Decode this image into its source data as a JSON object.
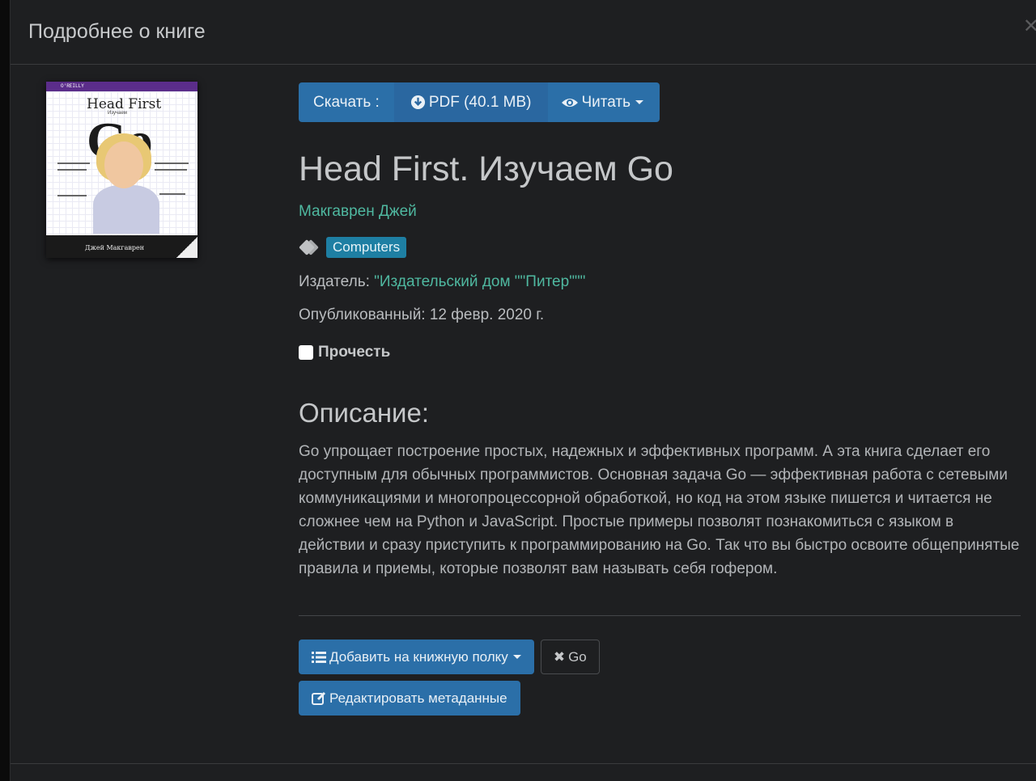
{
  "modal": {
    "title": "Подробнее о книге",
    "close_icon": "close-icon"
  },
  "book": {
    "title": "Head First. Изучаем Go",
    "author": "Макгаврен Джей",
    "tag": "Computers",
    "publisher_label": "Издатель:",
    "publisher": "\"Издательский дом \"\"Питер\"\"\"",
    "published": "Опубликованный: 12 февр. 2020 г.",
    "read_label": "Прочесть",
    "cover": {
      "brand": "O'REILLY",
      "series": "Head First",
      "subtitle": "Изучаем",
      "word": "Go",
      "author": "Джей Макгаврен"
    }
  },
  "download": {
    "label": "Скачать :",
    "pdf": "PDF (40.1 MB)",
    "read": "Читать"
  },
  "description": {
    "heading": "Описание:",
    "text": "Go упрощает построение простых, надежных и эффективных программ. А эта книга сделает его доступным для обычных программистов. Основная задача Go — эффективная работа с сетевыми коммуникациями и многопроцессорной обработкой, но код на этом языке пишется и читается не сложнее чем на Python и JavaScript. Простые примеры позволят познакомиться с языком в действии и сразу приступить к программированию на Go. Так что вы быстро освоите общепринятые правила и приемы, которые позволят вам называть себя гофером."
  },
  "actions": {
    "add_shelf": "Добавить на книжную полку",
    "go_button": "Go",
    "edit_metadata": "Редактировать метаданные"
  },
  "colors": {
    "accent": "#2b6fa8",
    "link": "#4fb8a0",
    "tag": "#1e7fa3",
    "background": "#1e1f21"
  }
}
